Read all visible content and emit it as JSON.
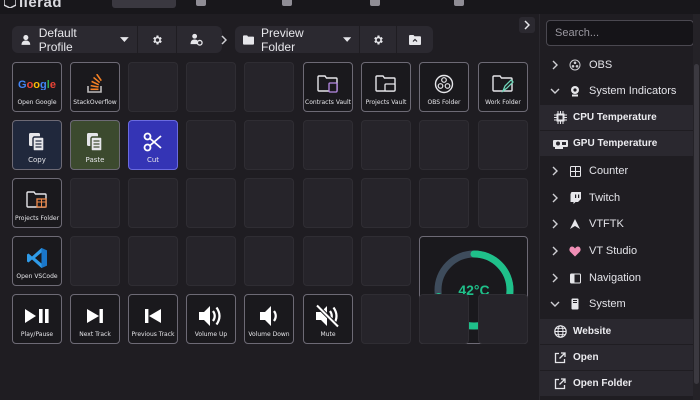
{
  "app": {
    "title": "ilerad",
    "accent": "#1fc08a"
  },
  "toolbar": {
    "profile_label": "Default Profile",
    "folder_label": "Preview Folder"
  },
  "grid": {
    "buttons": {
      "open_google": {
        "label": "Open Google",
        "icon": "google-logo"
      },
      "stackoverflow": {
        "label": "StackOverflow",
        "icon": "stackoverflow-icon"
      },
      "contracts_vault": {
        "label": "Contracts Vault",
        "icon": "folder-icon"
      },
      "projects_vault": {
        "label": "Projects Vault",
        "icon": "folder-icon"
      },
      "obs_folder": {
        "label": "OBS Folder",
        "icon": "obs-icon"
      },
      "work_folder": {
        "label": "Work Folder",
        "icon": "folder-icon"
      },
      "copy": {
        "label": "Copy",
        "icon": "copy-icon"
      },
      "paste": {
        "label": "Paste",
        "icon": "paste-icon"
      },
      "cut": {
        "label": "Cut",
        "icon": "scissors-icon"
      },
      "projects_folder": {
        "label": "Projects Folder",
        "icon": "folder-icon"
      },
      "open_vscode": {
        "label": "Open VSCode",
        "icon": "vscode-icon"
      },
      "play_pause": {
        "label": "Play/Pause",
        "icon": "play-pause-icon"
      },
      "next_track": {
        "label": "Next Track",
        "icon": "next-track-icon"
      },
      "previous_track": {
        "label": "Previous Track",
        "icon": "previous-track-icon"
      },
      "volume_up": {
        "label": "Volume Up",
        "icon": "volume-up-icon"
      },
      "volume_down": {
        "label": "Volume Down",
        "icon": "volume-down-icon"
      },
      "mute": {
        "label": "Mute",
        "icon": "mute-icon"
      }
    },
    "gauge": {
      "value_text": "42°C",
      "fraction": 0.72,
      "track_color": "#3e4c5c",
      "fill_color": "#1fc08a"
    }
  },
  "sidebar": {
    "search_placeholder": "Search...",
    "items": {
      "obs": {
        "label": "OBS",
        "expanded": false
      },
      "system_indicators": {
        "label": "System Indicators",
        "expanded": true,
        "children": {
          "cpu": "CPU Temperature",
          "gpu": "GPU Temperature"
        }
      },
      "counter": {
        "label": "Counter",
        "expanded": false
      },
      "twitch": {
        "label": "Twitch",
        "expanded": false
      },
      "vtftk": {
        "label": "VTFTK",
        "expanded": false
      },
      "vt_studio": {
        "label": "VT Studio",
        "expanded": false
      },
      "navigation": {
        "label": "Navigation",
        "expanded": false
      },
      "system": {
        "label": "System",
        "expanded": true,
        "children": {
          "website": "Website",
          "open": "Open",
          "open_folder": "Open Folder"
        }
      }
    }
  }
}
